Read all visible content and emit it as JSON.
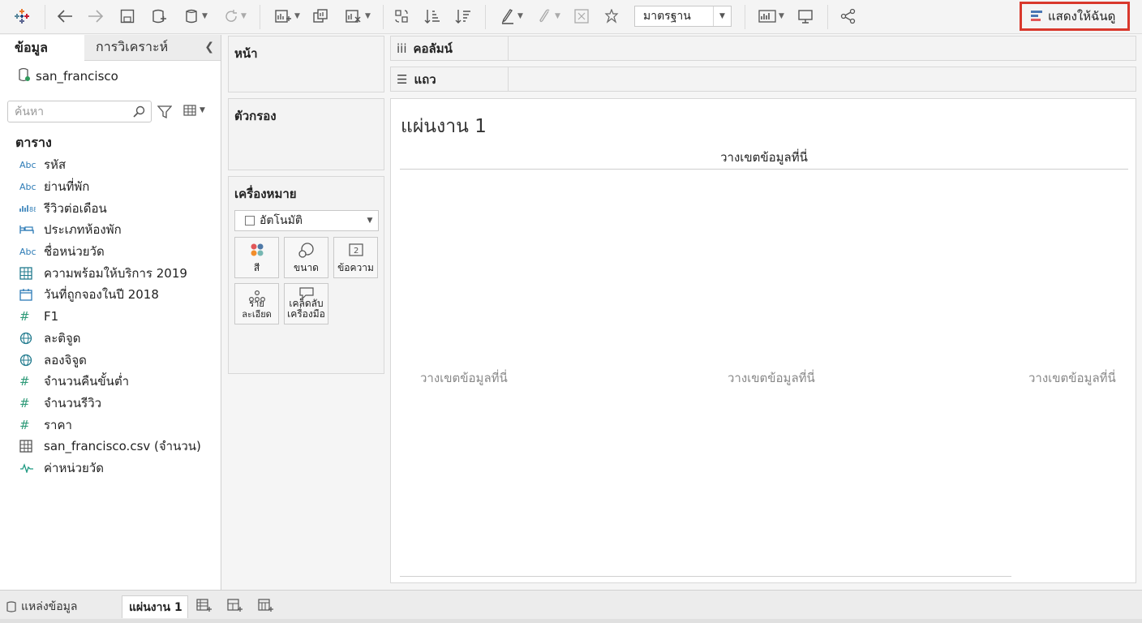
{
  "toolbar": {
    "standard_select": "มาตรฐาน",
    "show_me": "แสดงให้ฉันดู"
  },
  "data_pane": {
    "tab_data": "ข้อมูล",
    "tab_analysis": "การวิเคราะห์",
    "data_source": "san_francisco",
    "search_placeholder": "ค้นหา",
    "tables_title": "ตาราง",
    "fields": [
      {
        "label": "รหัส",
        "icon": "abc"
      },
      {
        "label": "ย่านที่พัก",
        "icon": "abc"
      },
      {
        "label": "รีวิวต่อเดือน",
        "icon": "bin"
      },
      {
        "label": "ประเภทห้องพัก",
        "icon": "bed"
      },
      {
        "label": "ชื่อหน่วยวัด",
        "icon": "abc"
      },
      {
        "label": "ความพร้อมให้บริการ 2019",
        "icon": "table"
      },
      {
        "label": "วันที่ถูกจองในปี 2018",
        "icon": "calendar"
      },
      {
        "label": "F1",
        "icon": "hash"
      },
      {
        "label": "ละติจูด",
        "icon": "globe"
      },
      {
        "label": "ลองจิจูด",
        "icon": "globe"
      },
      {
        "label": "จำนวนคืนขั้นต่ำ",
        "icon": "hash"
      },
      {
        "label": "จำนวนรีวิว",
        "icon": "hash"
      },
      {
        "label": "ราคา",
        "icon": "hash"
      },
      {
        "label": "san_francisco.csv (จำนวน)",
        "icon": "table"
      },
      {
        "label": "ค่าหน่วยวัด",
        "icon": "measure-wave"
      }
    ]
  },
  "cards": {
    "pages": "หน้า",
    "filters": "ตัวกรอง",
    "marks": "เครื่องหมาย",
    "mark_type": "อัตโนมัติ",
    "marks_buttons": {
      "color": "สี",
      "size": "ขนาด",
      "label": "ข้อความ",
      "detail": "รายละเอียด",
      "tooltip_line1": "เคล็ดลับ",
      "tooltip_line2": "เครื่องมือ"
    }
  },
  "shelves": {
    "columns": "คอลัมน์",
    "rows": "แถว"
  },
  "canvas": {
    "sheet_title": "แผ่นงาน 1",
    "drop_top": "วางเขตข้อมูลที่นี่",
    "drop_left": "วางเขตข้อมูลที่นี่",
    "drop_center": "วางเขตข้อมูลที่นี่",
    "drop_right": "วางเขตข้อมูลที่นี่"
  },
  "bottom": {
    "data_source_tab": "แหล่งข้อมูล",
    "sheet_tab": "แผ่นงาน 1"
  },
  "colors": {
    "show_me_border": "#d9382c",
    "field_icon_blue": "#2c7bb6",
    "field_icon_green": "#1f9a82"
  }
}
